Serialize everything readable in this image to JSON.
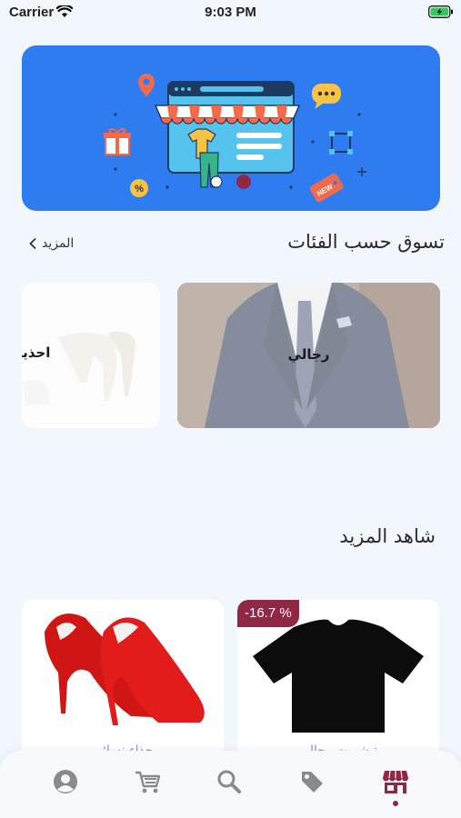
{
  "status_bar": {
    "carrier": "Carrier",
    "time": "9:03 PM"
  },
  "banner": {
    "badge_text": "NEW"
  },
  "categories_section": {
    "title": "تسوق حسب الفئات",
    "more_label": "المزيد",
    "items": [
      {
        "label": "رجالي"
      },
      {
        "label": "احذية"
      }
    ]
  },
  "more_section": {
    "title": "شاهد المزيد",
    "products": [
      {
        "name": "تيشيرت رجالي",
        "discount": "-16.7 %"
      },
      {
        "name": "حذاء نسائي"
      }
    ]
  },
  "tab_bar": {
    "tabs": [
      "profile-icon",
      "cart-icon",
      "search-icon",
      "tag-icon",
      "store-icon"
    ],
    "active": "store-icon"
  },
  "colors": {
    "accent": "#8f2745",
    "banner": "#2f7bf0",
    "background": "#f2f6fd"
  }
}
